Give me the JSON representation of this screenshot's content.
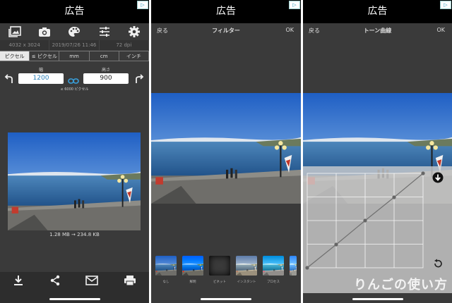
{
  "ad_label": "広告",
  "screen1": {
    "info": [
      "4032 x 3024",
      "2019/07/26 11:46",
      "72 dpi"
    ],
    "units": [
      "ピクセル",
      "≤ ピクセル",
      "mm",
      "cm",
      "インチ"
    ],
    "width_label": "幅",
    "height_label": "高さ",
    "width_value": "1200",
    "height_value": "900",
    "total_pixels": "≤ 6000 ピクセル",
    "file_size": "1.28 MB → 234.8 KB",
    "toolbar_icons": [
      "photo-library-icon",
      "camera-icon",
      "palette-icon",
      "sliders-icon",
      "gear-icon"
    ],
    "bottom_icons": [
      "download-icon",
      "share-icon",
      "mail-icon",
      "print-icon"
    ]
  },
  "screen2": {
    "back": "戻る",
    "title": "フィルター",
    "ok": "OK",
    "filters": [
      "なし",
      "鮮明",
      "ビネット",
      "インスタント",
      "プロセス"
    ]
  },
  "screen3": {
    "back": "戻る",
    "title": "トーン曲線",
    "ok": "OK"
  },
  "watermark": "りんごの使い方"
}
